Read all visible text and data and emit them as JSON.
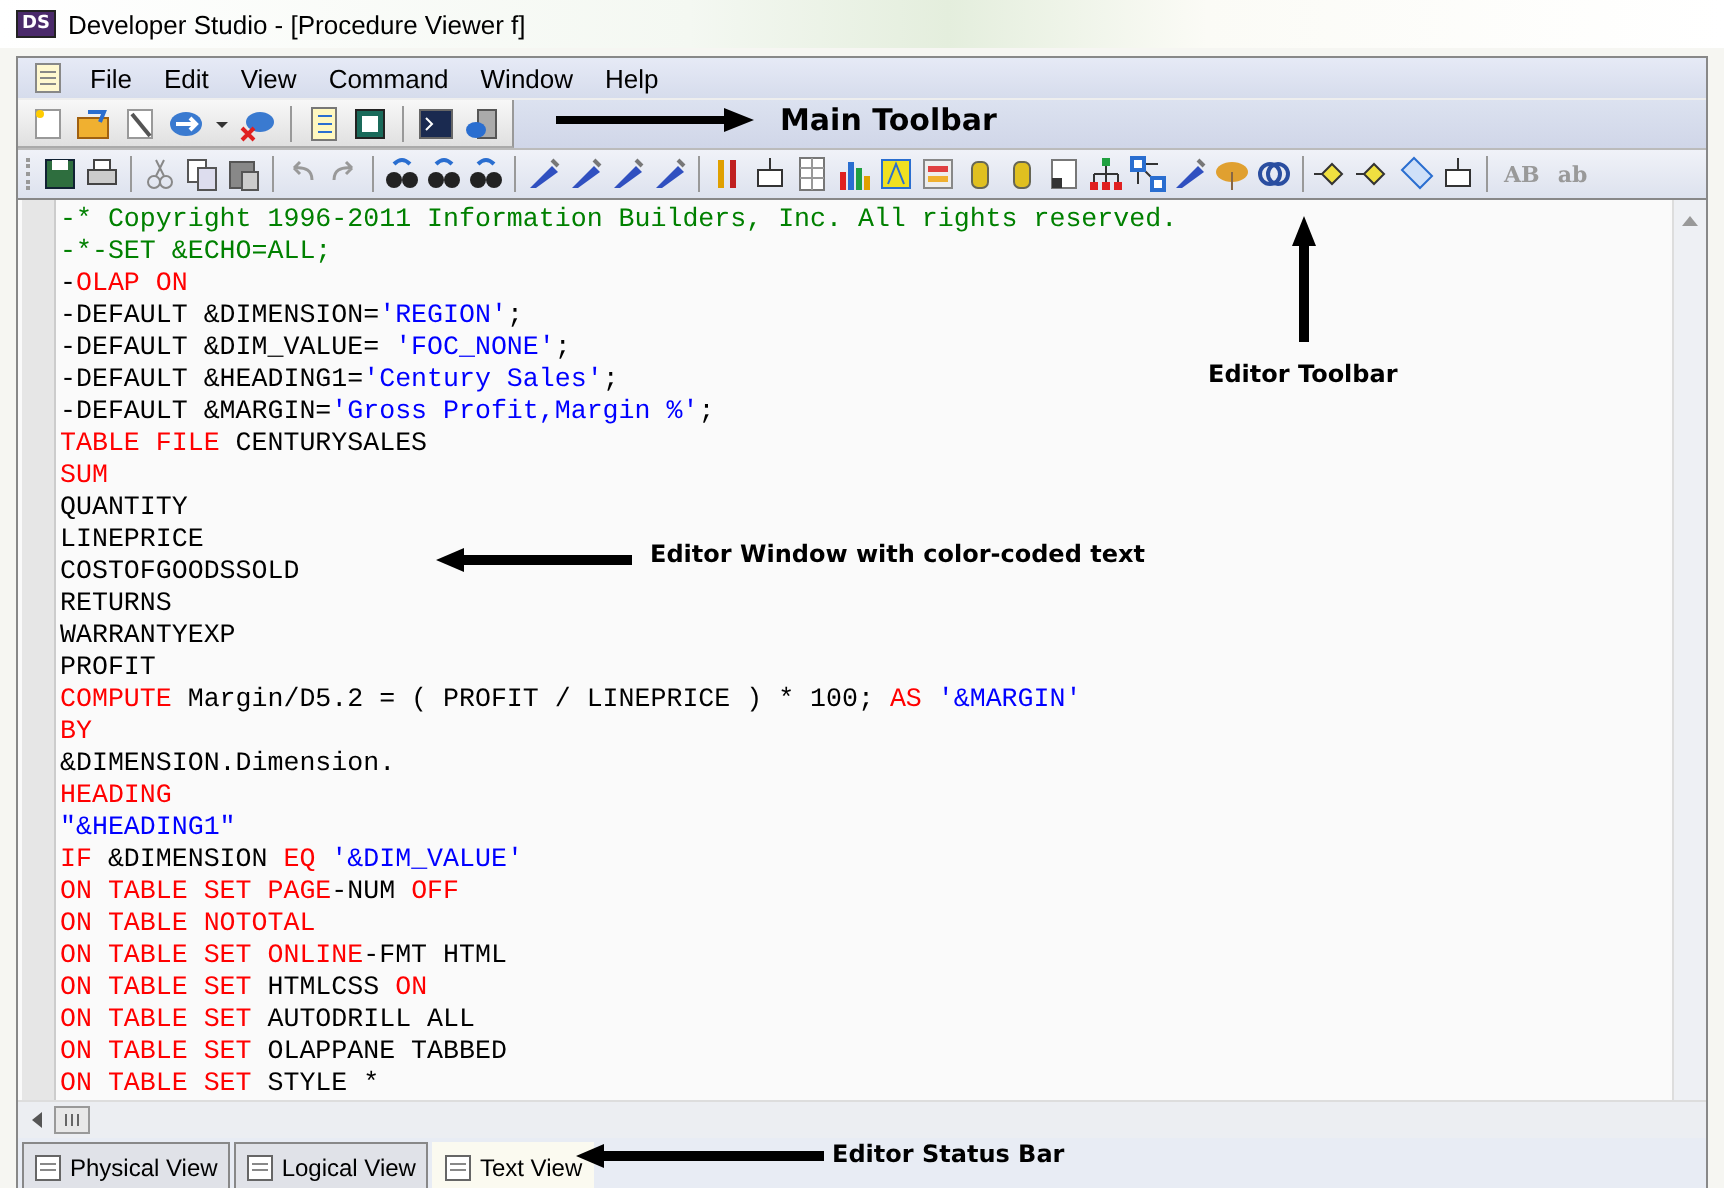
{
  "window": {
    "icon_label": "DS",
    "title": "Developer Studio - [Procedure Viewer f]"
  },
  "menu": [
    "File",
    "Edit",
    "View",
    "Command",
    "Window",
    "Help"
  ],
  "editor_toolbar": {
    "text_buttons": [
      "AB",
      "ab"
    ]
  },
  "editor": {
    "lines": [
      [
        {
          "kind": "comment",
          "text": "-* Copyright 1996-2011 Information Builders, Inc. All rights reserved."
        }
      ],
      [
        {
          "kind": "comment",
          "text": "-*-SET &ECHO=ALL;"
        }
      ],
      [
        {
          "kind": "plain",
          "text": "-"
        },
        {
          "kind": "keyword",
          "text": "OLAP ON"
        }
      ],
      [
        {
          "kind": "plain",
          "text": "-DEFAULT &DIMENSION="
        },
        {
          "kind": "string",
          "text": "'REGION'"
        },
        {
          "kind": "plain",
          "text": ";"
        }
      ],
      [
        {
          "kind": "plain",
          "text": "-DEFAULT &DIM_VALUE= "
        },
        {
          "kind": "string",
          "text": "'FOC_NONE'"
        },
        {
          "kind": "plain",
          "text": ";"
        }
      ],
      [
        {
          "kind": "plain",
          "text": "-DEFAULT &HEADING1="
        },
        {
          "kind": "string",
          "text": "'Century Sales'"
        },
        {
          "kind": "plain",
          "text": ";"
        }
      ],
      [
        {
          "kind": "plain",
          "text": "-DEFAULT &MARGIN="
        },
        {
          "kind": "string",
          "text": "'Gross Profit,Margin %'"
        },
        {
          "kind": "plain",
          "text": ";"
        }
      ],
      [
        {
          "kind": "keyword",
          "text": "TABLE FILE"
        },
        {
          "kind": "plain",
          "text": " CENTURYSALES"
        }
      ],
      [
        {
          "kind": "keyword",
          "text": "SUM"
        }
      ],
      [
        {
          "kind": "plain",
          "text": "QUANTITY"
        }
      ],
      [
        {
          "kind": "plain",
          "text": "LINEPRICE"
        }
      ],
      [
        {
          "kind": "plain",
          "text": "COSTOFGOODSSOLD"
        }
      ],
      [
        {
          "kind": "plain",
          "text": "RETURNS"
        }
      ],
      [
        {
          "kind": "plain",
          "text": "WARRANTYEXP"
        }
      ],
      [
        {
          "kind": "plain",
          "text": "PROFIT"
        }
      ],
      [
        {
          "kind": "keyword",
          "text": "COMPUTE"
        },
        {
          "kind": "plain",
          "text": " Margin/D5.2 = ( PROFIT / LINEPRICE ) * 100; "
        },
        {
          "kind": "keyword",
          "text": "AS"
        },
        {
          "kind": "string",
          "text": " '&MARGIN'"
        }
      ],
      [
        {
          "kind": "keyword",
          "text": "BY"
        }
      ],
      [
        {
          "kind": "plain",
          "text": "&DIMENSION.Dimension."
        }
      ],
      [
        {
          "kind": "keyword",
          "text": "HEADING"
        }
      ],
      [
        {
          "kind": "string",
          "text": "\"&HEADING1\""
        }
      ],
      [
        {
          "kind": "keyword",
          "text": "IF"
        },
        {
          "kind": "plain",
          "text": " &DIMENSION "
        },
        {
          "kind": "keyword",
          "text": "EQ"
        },
        {
          "kind": "string",
          "text": " '&DIM_VALUE'"
        }
      ],
      [
        {
          "kind": "keyword",
          "text": "ON TABLE SET PAGE"
        },
        {
          "kind": "plain",
          "text": "-NUM "
        },
        {
          "kind": "keyword",
          "text": "OFF"
        }
      ],
      [
        {
          "kind": "keyword",
          "text": "ON TABLE NOTOTAL"
        }
      ],
      [
        {
          "kind": "keyword",
          "text": "ON TABLE SET ONLINE"
        },
        {
          "kind": "plain",
          "text": "-FMT HTML"
        }
      ],
      [
        {
          "kind": "keyword",
          "text": "ON TABLE SET"
        },
        {
          "kind": "plain",
          "text": " HTMLCSS "
        },
        {
          "kind": "keyword",
          "text": "ON"
        }
      ],
      [
        {
          "kind": "keyword",
          "text": "ON TABLE SET"
        },
        {
          "kind": "plain",
          "text": " AUTODRILL ALL"
        }
      ],
      [
        {
          "kind": "keyword",
          "text": "ON TABLE SET"
        },
        {
          "kind": "plain",
          "text": " OLAPPANE TABBED"
        }
      ],
      [
        {
          "kind": "keyword",
          "text": "ON TABLE SET"
        },
        {
          "kind": "plain",
          "text": " STYLE *"
        }
      ]
    ]
  },
  "view_tabs": [
    {
      "label": "Physical View",
      "selected": false
    },
    {
      "label": "Logical View",
      "selected": false
    },
    {
      "label": "Text View",
      "selected": true
    }
  ],
  "annotations": {
    "main_toolbar": "Main Toolbar",
    "editor_toolbar": "Editor Toolbar",
    "editor_window": "Editor Window with color-coded text",
    "status_bar": "Editor Status Bar"
  }
}
